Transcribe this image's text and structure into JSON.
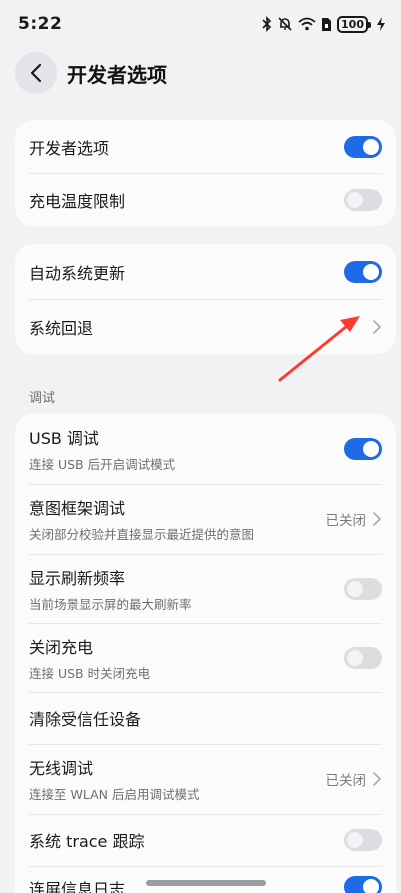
{
  "status_bar": {
    "time": "5:22",
    "battery": "100",
    "icons": [
      "bluetooth-icon",
      "mute-bell-icon",
      "wifi-icon",
      "sim-icon",
      "battery-icon",
      "charging-icon"
    ]
  },
  "header": {
    "title": "开发者选项",
    "back_icon": "chevron-left-icon"
  },
  "card1": [
    {
      "title": "开发者选项",
      "control": "toggle",
      "state": "on"
    },
    {
      "title": "充电温度限制",
      "control": "toggle",
      "state": "off"
    }
  ],
  "card2": [
    {
      "title": "自动系统更新",
      "control": "toggle",
      "state": "on"
    },
    {
      "title": "系统回退",
      "control": "chevron"
    }
  ],
  "debug_section": {
    "label": "调试",
    "items": [
      {
        "title": "USB 调试",
        "subtitle": "连接 USB 后开启调试模式",
        "control": "toggle",
        "state": "on"
      },
      {
        "title": "意图框架调试",
        "subtitle": "关闭部分校验并直接显示最近提供的意图",
        "value": "已关闭",
        "control": "chevron"
      },
      {
        "title": "显示刷新频率",
        "subtitle": "当前场景显示屏的最大刷新率",
        "control": "toggle",
        "state": "off"
      },
      {
        "title": "关闭充电",
        "subtitle": "连接 USB 时关闭充电",
        "control": "toggle",
        "state": "off"
      },
      {
        "title": "清除受信任设备",
        "control": "none"
      },
      {
        "title": "无线调试",
        "subtitle": "连接至 WLAN 后启用调试模式",
        "value": "已关闭",
        "control": "chevron"
      },
      {
        "title": "系统 trace 跟踪",
        "control": "toggle",
        "state": "off"
      },
      {
        "title": "连屏信息日志",
        "control": "toggle",
        "state": "on"
      }
    ]
  },
  "colors": {
    "accent": "#1f6ae6",
    "annotation_arrow": "#ff3b2f",
    "background": "#f1f2f4"
  }
}
